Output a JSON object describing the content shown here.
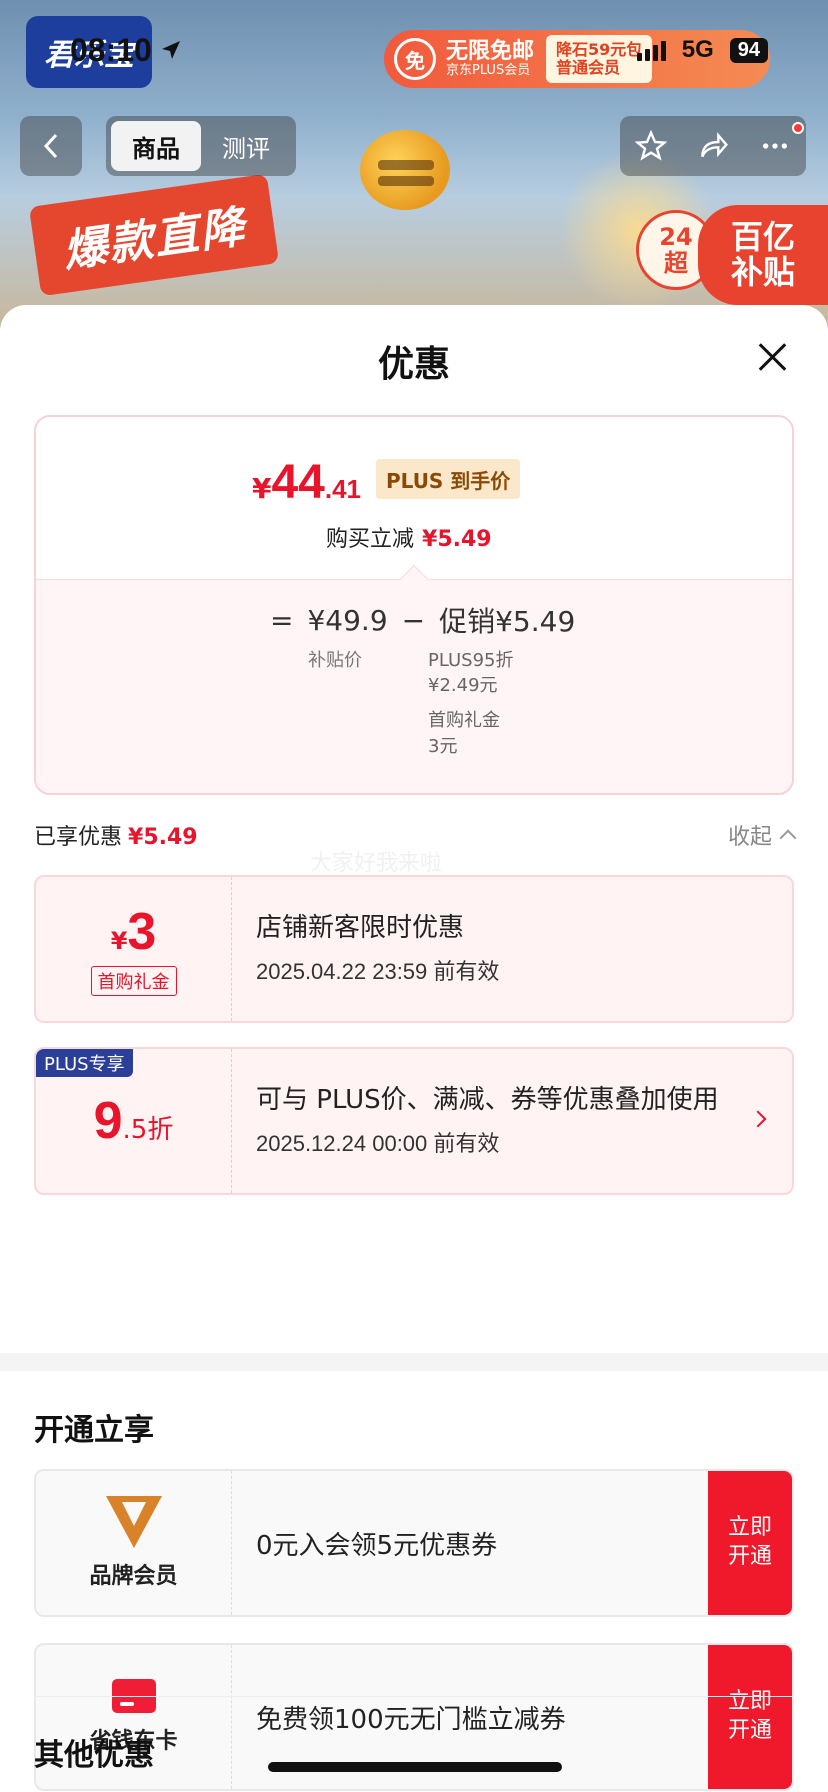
{
  "status": {
    "time": "08:10",
    "network": "5G",
    "battery": "94"
  },
  "banner": {
    "brand_logo": "君乐宝",
    "promo_free_icon": "免",
    "promo_main": "无限免邮",
    "promo_sub": "京东PLUS会员",
    "promo_right_1": "降石59元包",
    "promo_right_2": "普通会员",
    "ribbon": "爆款直降",
    "subsidy_line1": "百亿",
    "subsidy_line2": "补贴",
    "subsidy_badge_1": "24",
    "subsidy_badge_2": "超"
  },
  "nav": {
    "back_icon": "chevron-left-icon",
    "tabs": [
      {
        "label": "商品"
      },
      {
        "label": "测评"
      }
    ],
    "actions": [
      "star-icon",
      "share-icon",
      "more-icon"
    ]
  },
  "sheet": {
    "title": "优惠",
    "close_icon": "close-icon"
  },
  "price_card": {
    "currency": "¥",
    "price_int": "44",
    "price_dec": ".41",
    "plus_tag": "PLUS 到手价",
    "buy_reduce_label": "购买立减",
    "buy_reduce_value": "¥5.49",
    "eq_sign": "=",
    "subsidy_price": "¥49.9",
    "minus_sign": "−",
    "promo_total": "促销¥5.49",
    "subsidy_label": "补贴价",
    "promo_items": [
      {
        "line1": "PLUS95折",
        "line2": "¥2.49元"
      },
      {
        "line1": "首购礼金",
        "line2": "3元"
      }
    ]
  },
  "enjoyed": {
    "label": "已享优惠",
    "value": "¥5.49",
    "collapse": "收起"
  },
  "watermark": "大家好我来啦",
  "coupons": [
    {
      "currency": "¥",
      "amount": "3",
      "tag": "首购礼金",
      "title": "店铺新客限时优惠",
      "date": "2025.04.22 23:59 前有效"
    },
    {
      "badge": "PLUS专享",
      "amount": "9",
      "amount_dec": ".5折",
      "title": "可与 PLUS价、满减、券等优惠叠加使用",
      "date": "2025.12.24 00:00 前有效"
    }
  ],
  "open_section": {
    "title": "开通立享",
    "cards": [
      {
        "name": "品牌会员",
        "icon": "brand-member-icon",
        "desc": "0元入会领5元优惠券",
        "button": "立即开通"
      },
      {
        "name": "省钱东卡",
        "icon": "card-icon",
        "desc": "免费领100元无门槛立减券",
        "button": "立即开通"
      }
    ]
  },
  "other_section": {
    "title": "其他优惠"
  },
  "colors": {
    "accent_red": "#e8142c",
    "plus_blue": "#2b3f99",
    "button_red": "#f0182b"
  }
}
